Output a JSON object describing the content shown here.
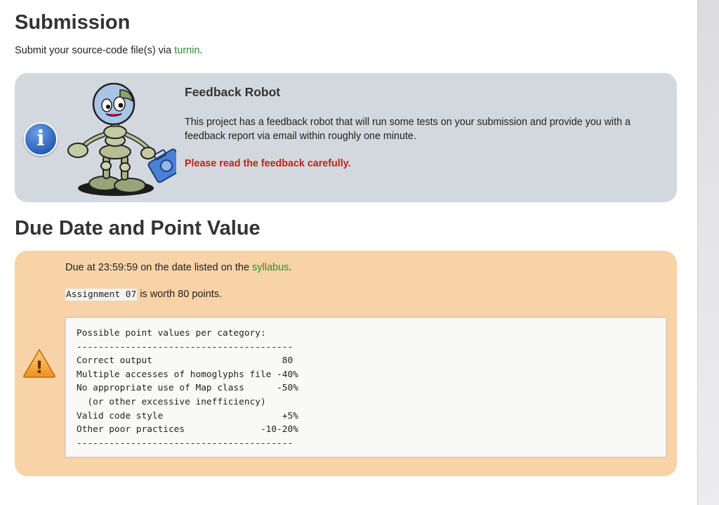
{
  "submission": {
    "heading": "Submission",
    "text_before": "Submit your source-code file(s) via ",
    "link": "turnin",
    "text_after": "."
  },
  "feedback": {
    "title": "Feedback Robot",
    "body": "This project has a feedback robot that will run some tests on your submission and provide you with a feedback report via email within roughly one minute.",
    "warning": "Please read the feedback carefully.",
    "info_icon": "info-icon",
    "info_glyph": "i",
    "robot": "robot-illustration"
  },
  "due": {
    "heading": "Due Date and Point Value",
    "due_before": "Due at 23:59:59 on the date listed on the ",
    "due_link": "syllabus",
    "due_after": ".",
    "assignment_code": "Assignment 07",
    "worth_text": " is worth 80 points.",
    "warning_icon": "warning-icon",
    "warning_glyph": "!"
  },
  "points": {
    "title": "Possible point values per category:",
    "rule": "----------------------------------------",
    "rows": [
      "Correct output                        80",
      "Multiple accesses of homoglyphs file -40%",
      "No appropriate use of Map class      -50%",
      "  (or other excessive inefficiency)",
      "Valid code style                      +5%",
      "Other poor practices              -10-20%"
    ]
  },
  "colors": {
    "link": "#2e8b2e",
    "warning_text": "#c0221b",
    "info_box": "#d3d8de",
    "warn_box": "#f8d3a7"
  }
}
